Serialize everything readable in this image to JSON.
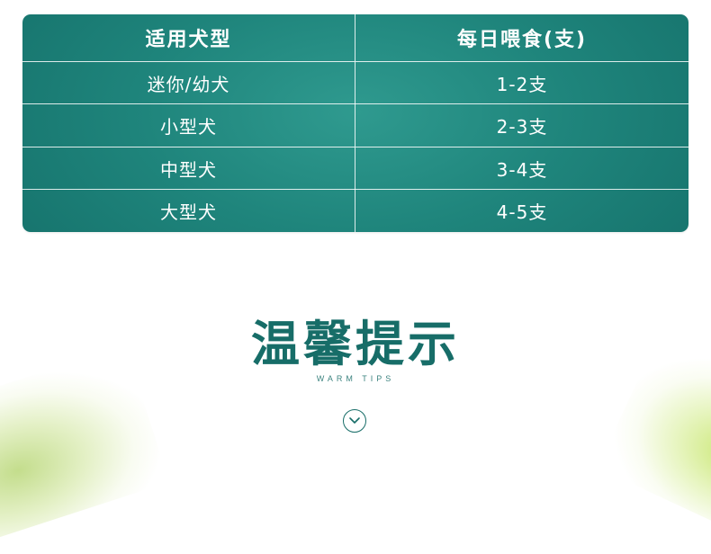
{
  "table": {
    "headers": [
      "适用犬型",
      "每日喂食(支)"
    ],
    "rows": [
      [
        "迷你/幼犬",
        "1-2支"
      ],
      [
        "小型犬",
        "2-3支"
      ],
      [
        "中型犬",
        "3-4支"
      ],
      [
        "大型犬",
        "4-5支"
      ]
    ]
  },
  "tips": {
    "title": "温馨提示",
    "subtitle": "WARM TIPS"
  },
  "icons": {
    "scroll": "chevron-down-icon"
  },
  "colors": {
    "table_teal": "#1f857c",
    "title_teal": "#176d68",
    "accent_green": "#c8e66e"
  }
}
